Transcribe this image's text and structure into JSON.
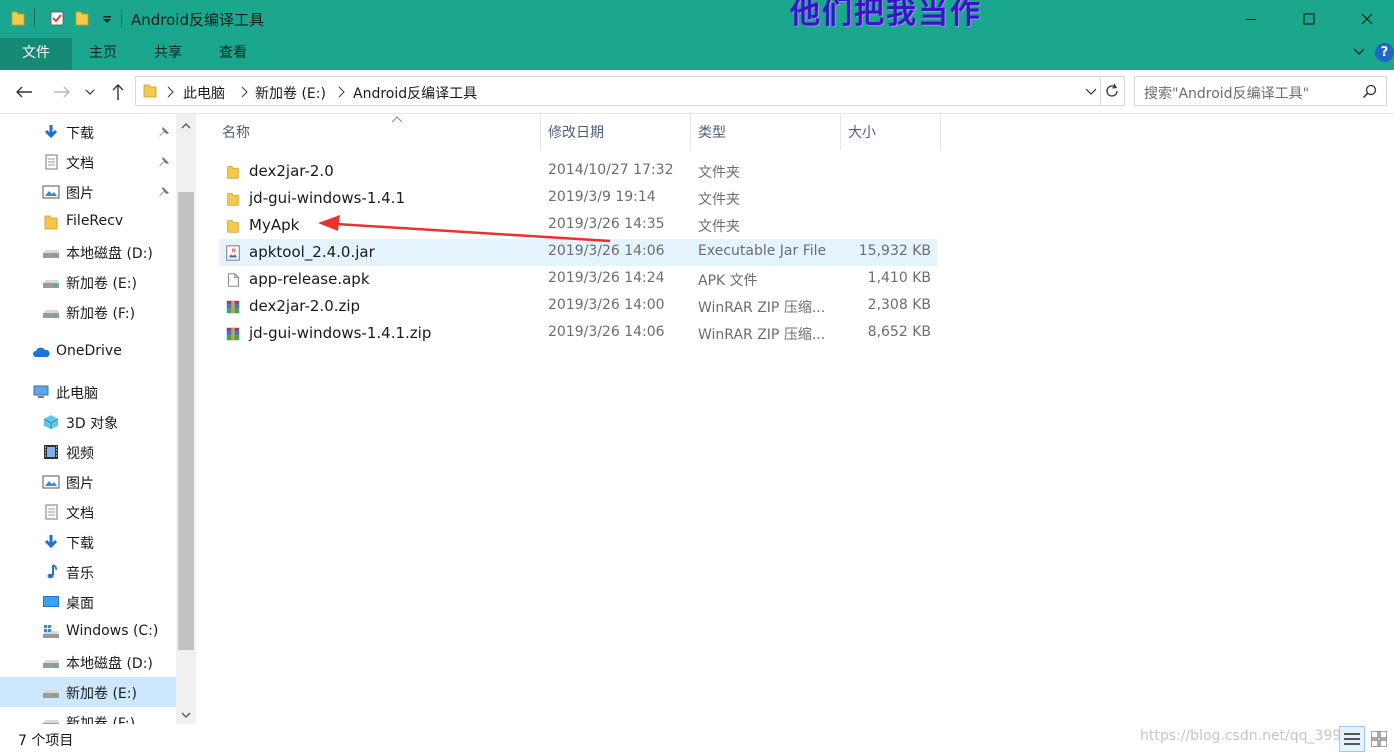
{
  "window": {
    "title": "Android反编译工具",
    "overlay_caption": "他们把我当作"
  },
  "ribbon": {
    "tabs": [
      "文件",
      "主页",
      "共享",
      "查看"
    ]
  },
  "address": {
    "breadcrumbs": [
      "此电脑",
      "新加卷 (E:)",
      "Android反编译工具"
    ],
    "search_placeholder": "搜索\"Android反编译工具\""
  },
  "sidebar": {
    "items": [
      {
        "label": "下载",
        "icon": "download-arrow-icon",
        "pinned": true
      },
      {
        "label": "文档",
        "icon": "document-icon",
        "pinned": true
      },
      {
        "label": "图片",
        "icon": "picture-icon",
        "pinned": true
      },
      {
        "label": "FileRecv",
        "icon": "folder-icon",
        "pinned": false
      },
      {
        "label": "本地磁盘 (D:)",
        "icon": "drive-icon",
        "pinned": false
      },
      {
        "label": "新加卷 (E:)",
        "icon": "drive-icon",
        "pinned": false
      },
      {
        "label": "新加卷 (F:)",
        "icon": "drive-icon",
        "pinned": false
      },
      {
        "label": "OneDrive",
        "icon": "onedrive-cloud-icon",
        "pinned": false
      },
      {
        "label": "此电脑",
        "icon": "this-pc-icon",
        "pinned": false
      },
      {
        "label": "3D 对象",
        "icon": "3d-objects-icon",
        "pinned": false
      },
      {
        "label": "视频",
        "icon": "video-icon",
        "pinned": false
      },
      {
        "label": "图片",
        "icon": "picture-icon",
        "pinned": false
      },
      {
        "label": "文档",
        "icon": "document-icon",
        "pinned": false
      },
      {
        "label": "下载",
        "icon": "download-arrow-icon",
        "pinned": false
      },
      {
        "label": "音乐",
        "icon": "music-note-icon",
        "pinned": false
      },
      {
        "label": "桌面",
        "icon": "desktop-icon",
        "pinned": false
      },
      {
        "label": "Windows (C:)",
        "icon": "windows-drive-icon",
        "pinned": false
      },
      {
        "label": "本地磁盘 (D:)",
        "icon": "drive-icon",
        "pinned": false
      },
      {
        "label": "新加卷 (E:)",
        "icon": "drive-icon",
        "pinned": false,
        "selected": true
      },
      {
        "label": "新加卷 (F:)",
        "icon": "drive-icon",
        "pinned": false
      }
    ]
  },
  "columns": {
    "name": "名称",
    "date": "修改日期",
    "type": "类型",
    "size": "大小"
  },
  "files": [
    {
      "name": "dex2jar-2.0",
      "date": "2014/10/27 17:32",
      "type": "文件夹",
      "size": "",
      "icon": "folder-icon"
    },
    {
      "name": "jd-gui-windows-1.4.1",
      "date": "2019/3/9 19:14",
      "type": "文件夹",
      "size": "",
      "icon": "folder-icon"
    },
    {
      "name": "MyApk",
      "date": "2019/3/26 14:35",
      "type": "文件夹",
      "size": "",
      "icon": "folder-icon"
    },
    {
      "name": "apktool_2.4.0.jar",
      "date": "2019/3/26 14:06",
      "type": "Executable Jar File",
      "size": "15,932 KB",
      "icon": "java-jar-icon",
      "highlighted": true
    },
    {
      "name": "app-release.apk",
      "date": "2019/3/26 14:24",
      "type": "APK 文件",
      "size": "1,410 KB",
      "icon": "blank-file-icon"
    },
    {
      "name": "dex2jar-2.0.zip",
      "date": "2019/3/26 14:00",
      "type": "WinRAR ZIP 压缩...",
      "size": "2,308 KB",
      "icon": "winrar-archive-icon"
    },
    {
      "name": "jd-gui-windows-1.4.1.zip",
      "date": "2019/3/26 14:06",
      "type": "WinRAR ZIP 压缩...",
      "size": "8,652 KB",
      "icon": "winrar-archive-icon"
    }
  ],
  "status": {
    "item_count": "7 个项目",
    "watermark": "https://blog.csdn.net/qq_399"
  },
  "colors": {
    "titlebar": "#1ba78d",
    "file_tab": "#148a74",
    "selection": "#cce8ff",
    "hover_row": "#e5f3ff",
    "annotation_arrow": "#e8322e"
  }
}
